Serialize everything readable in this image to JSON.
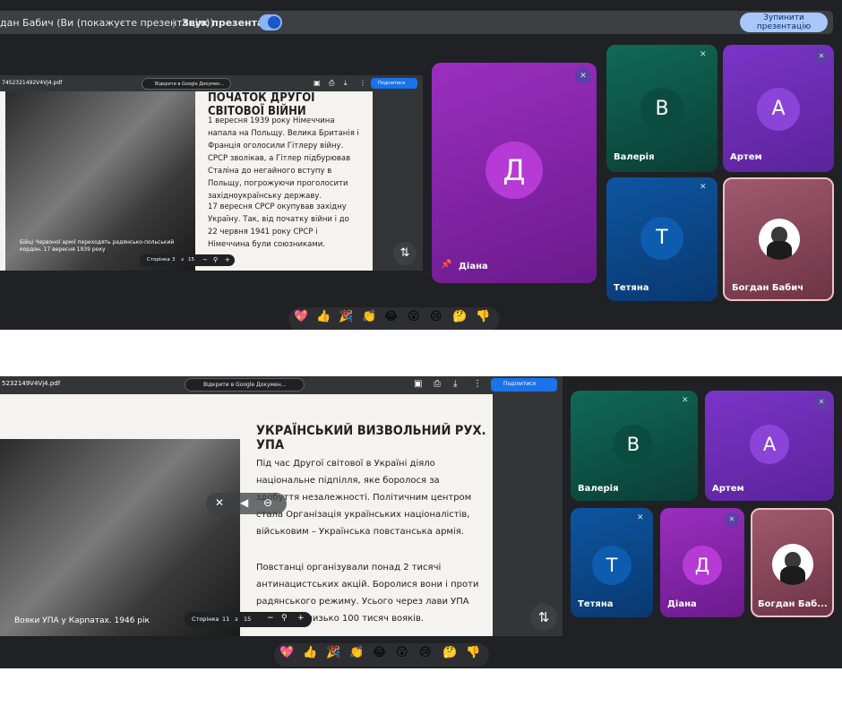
{
  "top_bar": {
    "presenter": "дан Бабич (Ви (покажуєте презентацію))",
    "sound": "Звук презентації",
    "stop_button": "Зупинити презентацію"
  },
  "screen1": {
    "filename": "7452321492V4Vj4.pdf",
    "open_button": "Відкрити в Google Докумен...",
    "share_button": "Поділитися",
    "slide_title": "ПОЧАТОК ДРУГОЇ СВІТОВОЇ ВІЙНИ",
    "paragraph1": "1 вересня 1939 року Німеччина напала на Польщу. Велика Британія і Франція оголосили Гітлеру війну. СРСР зволікав, а Гітлер підбурював Сталіна до негайного вступу в Польщу, погрожуючи проголосити західноукраїнську державу.",
    "paragraph2": "17 вересня СРСР окупував західну Україну. Так, від початку війни і до 22 червня 1941 року СРСР і Німеччина були союзниками.",
    "caption": "Бійці Червоної армії переходять радянсько-польський кордон. 17 вересня 1939 року",
    "page_label": "Сторінка",
    "page_current": "3",
    "page_sep": "з",
    "page_total": "15",
    "participants": {
      "diana": {
        "initial": "Д",
        "name": "Діана"
      },
      "valeria": {
        "initial": "В",
        "name": "Валерія"
      },
      "artem": {
        "initial": "А",
        "name": "Артем"
      },
      "tetiana": {
        "initial": "Т",
        "name": "Тетяна"
      },
      "bohdan": {
        "name": "Богдан Бабич"
      }
    }
  },
  "screen2": {
    "filename": "5232149V4Vj4.pdf",
    "open_button": "Відкрити в Google Докумен...",
    "share_button": "Поділитися",
    "slide_title": "УКРАЇНСЬКИЙ ВИЗВОЛЬНИЙ РУХ. УПА",
    "paragraph1": "Під час Другої світової в Україні діяло національне підпілля, яке боролося за здобуття незалежності. Політичним центром стала Організація українських націоналістів, військовим – Українська повстанська армія.",
    "paragraph2": "Повстанці організували понад 2 тисячі антинацистських акцій. Боролися вони і проти радянського режиму. Усього через лави УПА пройшло близько 100 тисяч вояків.",
    "caption": "Вояки УПА у Карпатах. 1946 рік",
    "page_label": "Сторінка",
    "page_current": "11",
    "page_sep": "з",
    "page_total": "15",
    "participants": {
      "valeria": {
        "initial": "В",
        "name": "Валерія"
      },
      "artem": {
        "initial": "А",
        "name": "Артем"
      },
      "tetiana": {
        "initial": "Т",
        "name": "Тетяна"
      },
      "diana": {
        "initial": "Д",
        "name": "Діана"
      },
      "bohdan": {
        "name": "Богдан Баб..."
      }
    }
  },
  "reactions": [
    "💖",
    "👍",
    "🎉",
    "👏",
    "😂",
    "😮",
    "😢",
    "🤔",
    "👎"
  ],
  "icons": {
    "mic_off": "mic-off-icon",
    "pin": "pin-icon",
    "rotate": "rotate-icon",
    "zoom": "zoom-icon"
  },
  "colors": {
    "meet_bg": "#202124",
    "valeria_tile": "#0d5a4a",
    "artem_tile": "#6b2aa8",
    "tetiana_tile": "#0b4a8a",
    "diana_tile": "#8a1f9e",
    "bohdan_tile": "#8a4a5e",
    "accent": "#8ab4f8"
  }
}
